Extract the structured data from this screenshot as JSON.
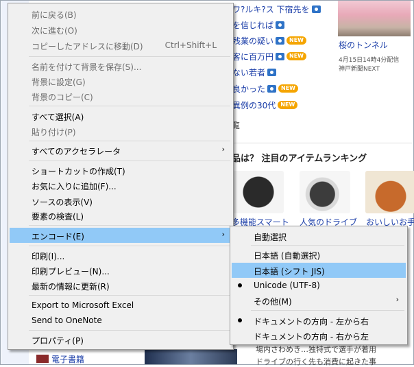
{
  "background": {
    "news": [
      {
        "text": "ワ?ルキ?ス 下宿先を",
        "camera": true,
        "new": false
      },
      {
        "text": "を信じれば",
        "camera": true,
        "new": false
      },
      {
        "text": "残業の疑い",
        "camera": true,
        "new": true
      },
      {
        "text": "客に百万円",
        "camera": true,
        "new": true
      },
      {
        "text": "ない若者",
        "camera": true,
        "new": false
      },
      {
        "text": "良かった",
        "camera": true,
        "new": true
      },
      {
        "text": "異例の30代",
        "camera": true,
        "new": true
      }
    ],
    "news_more": "覧",
    "photo": {
      "caption": "桜のトンネル",
      "time": "4月15日14時4分配信",
      "source": "神戸新聞NEXT"
    },
    "ranking_title": "品は？ 注目のアイテムランキング",
    "thumbs": [
      "多機能スマート",
      "人気のドライブ",
      "おいしいお手軽"
    ],
    "bottom_label": "電子書籍",
    "bottom_news": [
      "場内さわめき…独特式で選手が着用",
      "ドライブの行く先も消費に起きた事"
    ],
    "new_badge": "NEW",
    "colors": {
      "link": "#1a3da8",
      "highlight": "#91c9f7",
      "camera": "#2f73c7",
      "new_badge": "#f5a500"
    }
  },
  "context_menu": {
    "items": [
      {
        "label": "前に戻る(B)",
        "disabled": true
      },
      {
        "label": "次に進む(O)",
        "disabled": true
      },
      {
        "label": "コピーしたアドレスに移動(D)",
        "shortcut": "Ctrl+Shift+L",
        "disabled": true
      },
      {
        "label": "名前を付けて背景を保存(S)...",
        "disabled": true
      },
      {
        "label": "背景に設定(G)",
        "disabled": true
      },
      {
        "label": "背景のコピー(C)",
        "disabled": true
      },
      {
        "label": "すべて選択(A)",
        "disabled": false
      },
      {
        "label": "貼り付け(P)",
        "disabled": true
      },
      {
        "label": "すべてのアクセラレータ",
        "disabled": false,
        "submenu": true
      },
      {
        "label": "ショートカットの作成(T)",
        "disabled": false
      },
      {
        "label": "お気に入りに追加(F)...",
        "disabled": false
      },
      {
        "label": "ソースの表示(V)",
        "disabled": false
      },
      {
        "label": "要素の検査(L)",
        "disabled": false
      },
      {
        "label": "エンコード(E)",
        "disabled": false,
        "submenu": true,
        "highlighted": true
      },
      {
        "label": "印刷(I)...",
        "disabled": false
      },
      {
        "label": "印刷プレビュー(N)...",
        "disabled": false
      },
      {
        "label": "最新の情報に更新(R)",
        "disabled": false
      },
      {
        "label": "Export to Microsoft Excel",
        "disabled": false
      },
      {
        "label": "Send to OneNote",
        "disabled": false
      },
      {
        "label": "プロパティ(P)",
        "disabled": false
      }
    ]
  },
  "encoding_submenu": {
    "items": [
      {
        "label": "自動選択"
      },
      {
        "label": "日本語 (自動選択)"
      },
      {
        "label": "日本語 (シフト JIS)",
        "highlighted": true
      },
      {
        "label": "Unicode (UTF-8)",
        "checked": true
      },
      {
        "label": "その他(M)",
        "submenu": true
      },
      {
        "label": "ドキュメントの方向 - 左から右",
        "checked": true
      },
      {
        "label": "ドキュメントの方向 - 右から左"
      }
    ]
  },
  "glyphs": {
    "submenu_arrow": "›"
  }
}
